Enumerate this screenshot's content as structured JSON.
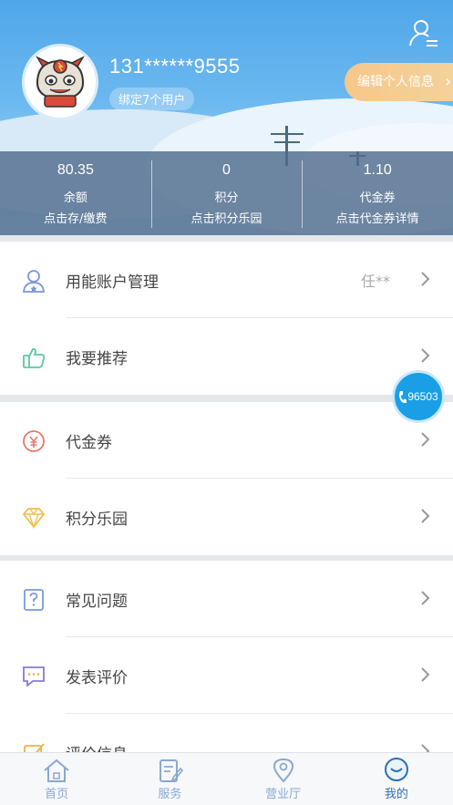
{
  "header": {
    "phone": "131******9555",
    "bind_badge": "绑定7个用户",
    "edit_label": "编辑个人信息",
    "edit_chevron": "›"
  },
  "stats": [
    {
      "value": "80.35",
      "label": "余额",
      "sub": "点击存/缴费"
    },
    {
      "value": "0",
      "label": "积分",
      "sub": "点击积分乐园"
    },
    {
      "value": "1.10",
      "label": "代金券",
      "sub": "点击代金券详情"
    }
  ],
  "menu": {
    "group1": [
      {
        "label": "用能账户管理",
        "value": "任**",
        "icon": "user-account-icon",
        "color": "#6a8fd8"
      },
      {
        "label": "我要推荐",
        "value": "",
        "icon": "thumbs-up-icon",
        "color": "#5cc9a0"
      }
    ],
    "group2": [
      {
        "label": "代金券",
        "value": "",
        "icon": "voucher-icon",
        "color": "#e8776a"
      },
      {
        "label": "积分乐园",
        "value": "",
        "icon": "diamond-icon",
        "color": "#f0c04a"
      }
    ],
    "group3": [
      {
        "label": "常见问题",
        "value": "",
        "icon": "question-icon",
        "color": "#7b9ad8"
      },
      {
        "label": "发表评价",
        "value": "",
        "icon": "comment-icon",
        "color": "#8a7ad8"
      },
      {
        "label": "评价信息",
        "value": "",
        "icon": "review-icon",
        "color": "#f0b040"
      }
    ]
  },
  "hotline": "96503",
  "tabs": [
    {
      "label": "首页",
      "icon": "home-icon"
    },
    {
      "label": "服务",
      "icon": "service-icon"
    },
    {
      "label": "营业厅",
      "icon": "location-icon"
    },
    {
      "label": "我的",
      "icon": "profile-icon",
      "active": true
    }
  ],
  "colors": {
    "accent": "#1a9fe6",
    "header_blue": "#4fa7ea",
    "edit_orange": "#f7c78a",
    "tab_active": "#2e6fb8"
  }
}
